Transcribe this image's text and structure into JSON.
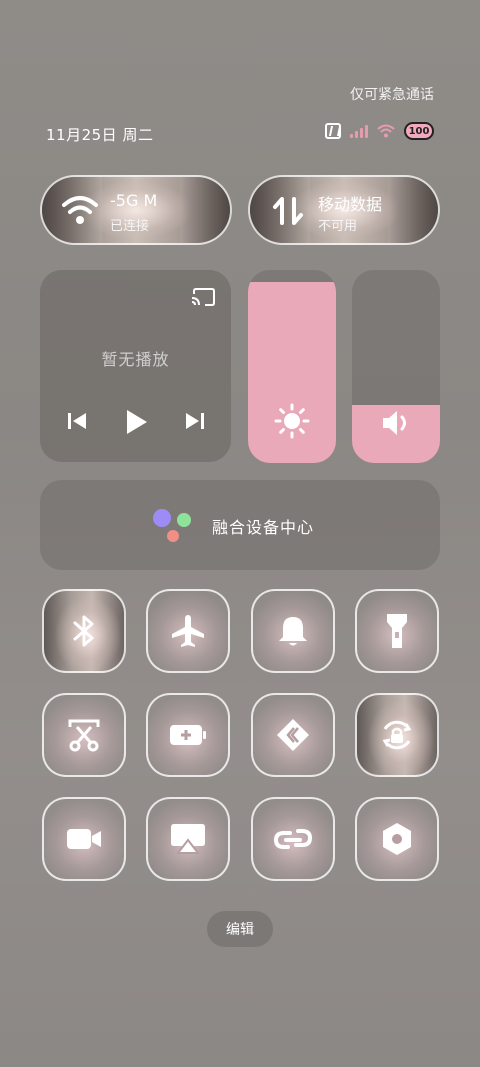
{
  "status": {
    "emergency_text": "仅可紧急通话",
    "date_text": "11月25日 周二",
    "battery_level": "100",
    "accent_color": "#e9a9b9"
  },
  "tiles_top": {
    "wifi": {
      "title": "-5G     M",
      "subtitle": "已连接",
      "icon": "wifi-icon"
    },
    "mobile_data": {
      "title": "移动数据",
      "subtitle": "不可用",
      "icon": "data-arrows-icon"
    }
  },
  "media": {
    "status_text": "暂无播放",
    "icons": [
      "cast-icon",
      "previous-icon",
      "play-icon",
      "next-icon"
    ]
  },
  "sliders": {
    "brightness_level": 0.94,
    "volume_level": 0.3
  },
  "device_center": {
    "label": "融合设备中心"
  },
  "toggles": [
    {
      "icon": "bluetooth-icon"
    },
    {
      "icon": "airplane-icon"
    },
    {
      "icon": "bell-icon"
    },
    {
      "icon": "flashlight-icon"
    },
    {
      "icon": "screenshot-scissors-icon"
    },
    {
      "icon": "battery-saver-icon"
    },
    {
      "icon": "share-icon"
    },
    {
      "icon": "rotation-lock-icon"
    },
    {
      "icon": "video-camera-icon"
    },
    {
      "icon": "screen-mirror-icon"
    },
    {
      "icon": "link-icon"
    },
    {
      "icon": "settings-hex-icon"
    }
  ],
  "edit_label": "编辑"
}
